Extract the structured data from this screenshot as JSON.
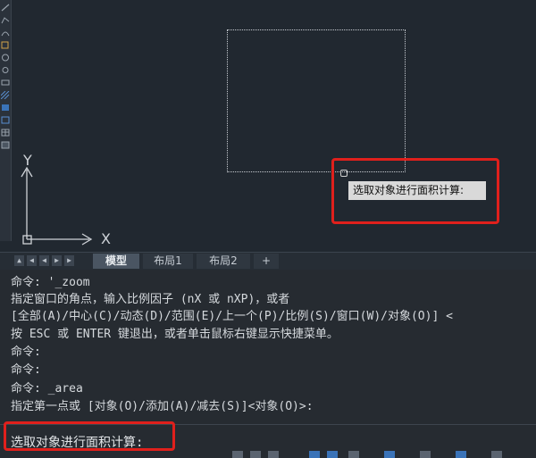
{
  "canvas": {
    "tooltip": "选取对象进行面积计算:",
    "ucs_x_label": "X",
    "ucs_y_label": "Y"
  },
  "tabs": {
    "nav": [
      "▲",
      "◀",
      "◀",
      "▶",
      "▶"
    ],
    "items": [
      {
        "label": "模型",
        "active": true
      },
      {
        "label": "布局1",
        "active": false
      },
      {
        "label": "布局2",
        "active": false
      },
      {
        "label": "+",
        "active": false
      }
    ]
  },
  "command_history": [
    "命令: '_zoom",
    "指定窗口的角点，输入比例因子 (nX 或 nXP)，或者",
    "[全部(A)/中心(C)/动态(D)/范围(E)/上一个(P)/比例(S)/窗口(W)/对象(O)] <",
    "按 ESC 或 ENTER 键退出，或者单击鼠标右键显示快捷菜单。",
    "命令:",
    "命令:",
    "命令: _area",
    "指定第一点或 [对象(O)/添加(A)/减去(S)]<对象(O)>:"
  ],
  "command_input": "选取对象进行面积计算:",
  "colors": {
    "highlight": "#e0201c",
    "canvas_bg": "#212830",
    "command_bg": "#262b31"
  }
}
